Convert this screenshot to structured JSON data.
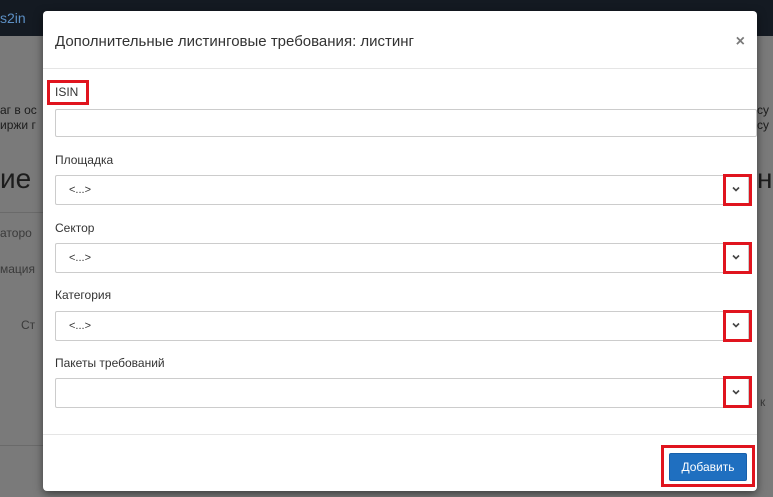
{
  "background": {
    "logo_fragment": "s2in",
    "text_left_1": "аг в ос",
    "text_left_2": "иржи г",
    "heading_left": "ие",
    "heading_right": "на",
    "nav_left_1": "аторо",
    "nav_left_2": "мация",
    "nav_left_3": "Ст",
    "text_right_1": "су",
    "text_right_2": "су",
    "text_right_3": "к"
  },
  "modal": {
    "title": "Дополнительные листинговые требования: листинг",
    "close_symbol": "×",
    "fields": {
      "isin": {
        "label": "ISIN",
        "value": ""
      },
      "platform": {
        "label": "Площадка",
        "value": "<...>"
      },
      "sector": {
        "label": "Сектор",
        "value": "<...>"
      },
      "category": {
        "label": "Категория",
        "value": "<...>"
      },
      "packages": {
        "label": "Пакеты требований",
        "value": ""
      }
    },
    "add_button": "Добавить"
  },
  "colors": {
    "highlight": "#e0141e",
    "primary_button": "#1f6fc0"
  }
}
